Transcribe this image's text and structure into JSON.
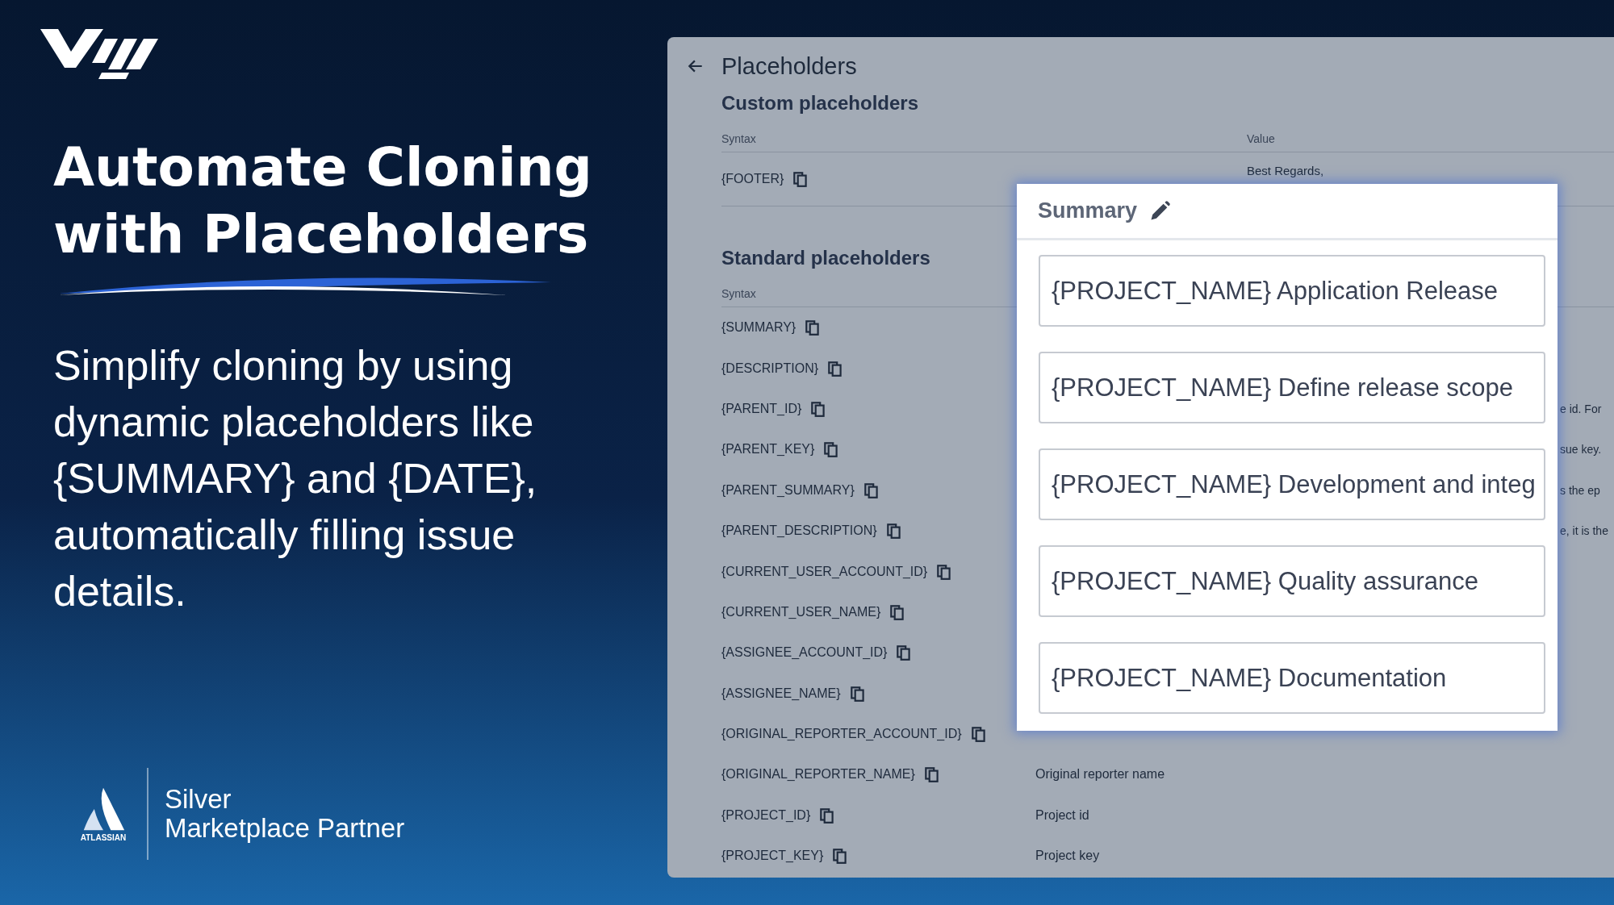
{
  "headline": "Automate Cloning with Placeholders",
  "description": "Simplify cloning by using dynamic placeholders like {SUMMARY} and {DATE}, automatically filling issue details.",
  "partner": {
    "brand": "ATLASSIAN",
    "tier": "Silver",
    "program": "Marketplace Partner"
  },
  "app": {
    "title": "Placeholders",
    "custom_section": {
      "title": "Custom placeholders",
      "columns": [
        "Syntax",
        "Value"
      ],
      "rows": [
        {
          "syntax": "{FOOTER}",
          "value": "Best Regards,"
        }
      ]
    },
    "standard_section": {
      "title": "Standard placeholders",
      "columns": [
        "Syntax"
      ],
      "rows": [
        {
          "syntax": "{SUMMARY}"
        },
        {
          "syntax": "{DESCRIPTION}"
        },
        {
          "syntax": "{PARENT_ID}",
          "value": "e id. For",
          "kind": "clipped"
        },
        {
          "syntax": "{PARENT_KEY}",
          "value": "sue key.",
          "kind": "clipped"
        },
        {
          "syntax": "{PARENT_SUMMARY}",
          "value": "s the ep",
          "kind": "clipped"
        },
        {
          "syntax": "{PARENT_DESCRIPTION}",
          "value": "e, it is the",
          "kind": "clipped"
        },
        {
          "syntax": "{CURRENT_USER_ACCOUNT_ID}"
        },
        {
          "syntax": "{CURRENT_USER_NAME}"
        },
        {
          "syntax": "{ASSIGNEE_ACCOUNT_ID}"
        },
        {
          "syntax": "{ASSIGNEE_NAME}"
        },
        {
          "syntax": "{ORIGINAL_REPORTER_ACCOUNT_ID}"
        },
        {
          "syntax": "{ORIGINAL_REPORTER_NAME}",
          "value": "Original reporter name",
          "kind": "full"
        },
        {
          "syntax": "{PROJECT_ID}",
          "value": "Project id",
          "kind": "full"
        },
        {
          "syntax": "{PROJECT_KEY}",
          "value": "Project key",
          "kind": "full"
        }
      ]
    },
    "dialog": {
      "label": "Summary",
      "fields": [
        "{PROJECT_NAME} Application Release",
        "{PROJECT_NAME} Define release scope",
        "{PROJECT_NAME} Development and integ",
        "{PROJECT_NAME} Quality assurance",
        "{PROJECT_NAME} Documentation"
      ]
    }
  }
}
